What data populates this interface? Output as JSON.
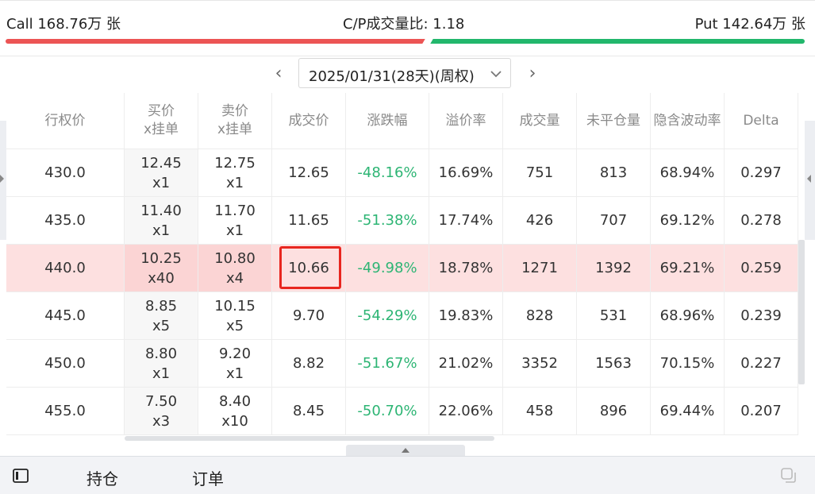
{
  "summary": {
    "call": "Call 168.76万 张",
    "cp_ratio": "C/P成交量比:  1.18",
    "put": "Put 142.64万 张"
  },
  "date_nav": {
    "date": "2025/01/31(28天)(周权)"
  },
  "table": {
    "headers": {
      "strike": "行权价",
      "bid": "买价",
      "bid_sub": "x挂单",
      "ask": "卖价",
      "ask_sub": "x挂单",
      "last": "成交价",
      "change": "涨跌幅",
      "premium": "溢价率",
      "volume": "成交量",
      "oi": "未平仓量",
      "iv": "隐含波动率",
      "delta": "Delta"
    },
    "rows": [
      {
        "strike": "430.0",
        "bid": "12.45",
        "bid_size": "x1",
        "ask": "12.75",
        "ask_size": "x1",
        "last": "12.65",
        "change": "-48.16%",
        "premium": "16.69%",
        "volume": "751",
        "oi": "813",
        "iv": "68.94%",
        "delta": "0.297"
      },
      {
        "strike": "435.0",
        "bid": "11.40",
        "bid_size": "x1",
        "ask": "11.70",
        "ask_size": "x1",
        "last": "11.65",
        "change": "-51.38%",
        "premium": "17.74%",
        "volume": "426",
        "oi": "707",
        "iv": "69.12%",
        "delta": "0.278"
      },
      {
        "strike": "440.0",
        "bid": "10.25",
        "bid_size": "x40",
        "ask": "10.80",
        "ask_size": "x4",
        "last": "10.66",
        "change": "-49.98%",
        "premium": "18.78%",
        "volume": "1271",
        "oi": "1392",
        "iv": "69.21%",
        "delta": "0.259"
      },
      {
        "strike": "445.0",
        "bid": "8.85",
        "bid_size": "x5",
        "ask": "10.15",
        "ask_size": "x5",
        "last": "9.70",
        "change": "-54.29%",
        "premium": "19.83%",
        "volume": "828",
        "oi": "531",
        "iv": "68.96%",
        "delta": "0.239"
      },
      {
        "strike": "450.0",
        "bid": "8.80",
        "bid_size": "x1",
        "ask": "9.20",
        "ask_size": "x1",
        "last": "8.82",
        "change": "-51.67%",
        "premium": "21.02%",
        "volume": "3352",
        "oi": "1563",
        "iv": "70.15%",
        "delta": "0.227"
      },
      {
        "strike": "455.0",
        "bid": "7.50",
        "bid_size": "x3",
        "ask": "8.40",
        "ask_size": "x10",
        "last": "8.45",
        "change": "-50.70%",
        "premium": "22.06%",
        "volume": "458",
        "oi": "896",
        "iv": "69.44%",
        "delta": "0.207"
      }
    ]
  },
  "bottom": {
    "tab_positions": "持仓",
    "tab_orders": "订单"
  },
  "colors": {
    "call": "#ec5454",
    "put": "#22b76c",
    "negative": "#2db574",
    "highlight_row": "#fde0e0",
    "highlight_box": "#e8261f"
  }
}
